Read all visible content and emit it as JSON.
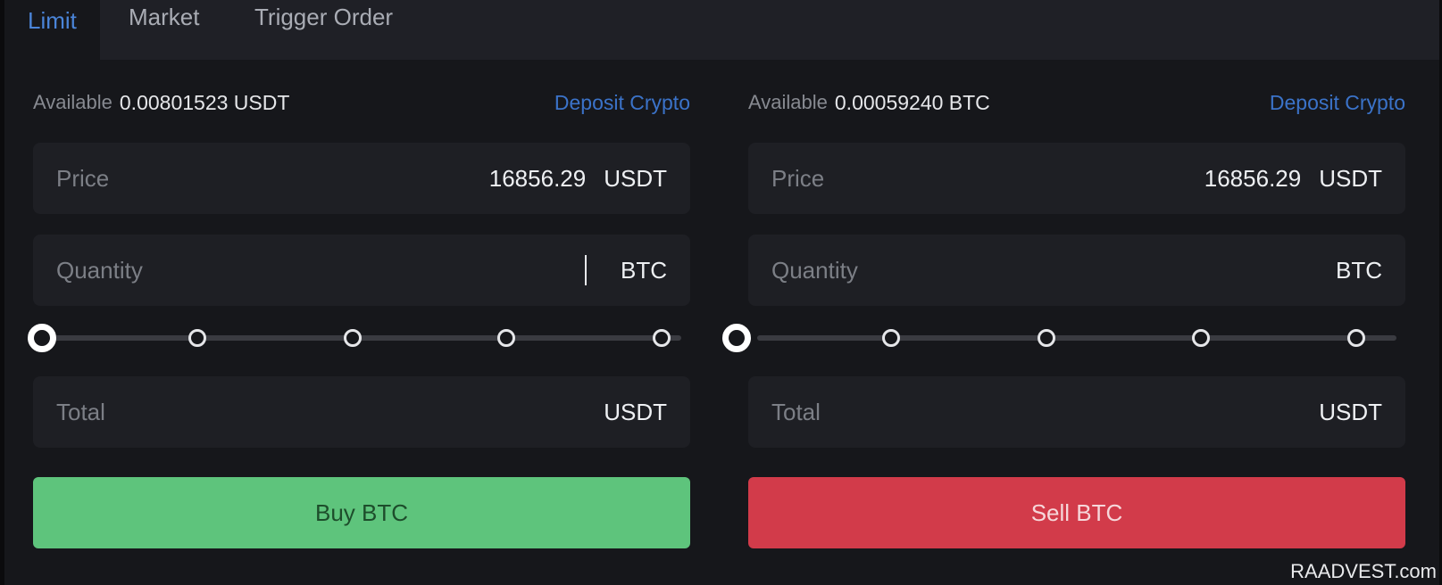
{
  "tabs": [
    {
      "label": "Limit",
      "active": true
    },
    {
      "label": "Market",
      "active": false
    },
    {
      "label": "Trigger Order",
      "active": false
    }
  ],
  "buy": {
    "available_label": "Available",
    "available_value": "0.00801523 USDT",
    "deposit_label": "Deposit Crypto",
    "price_label": "Price",
    "price_value": "16856.29",
    "price_unit": "USDT",
    "quantity_placeholder": "Quantity",
    "quantity_unit": "BTC",
    "total_label": "Total",
    "total_unit": "USDT",
    "slider_percent": 0,
    "button_label": "Buy BTC"
  },
  "sell": {
    "available_label": "Available",
    "available_value": "0.00059240 BTC",
    "deposit_label": "Deposit Crypto",
    "price_label": "Price",
    "price_value": "16856.29",
    "price_unit": "USDT",
    "quantity_placeholder": "Quantity",
    "quantity_unit": "BTC",
    "total_label": "Total",
    "total_unit": "USDT",
    "slider_percent": 0,
    "button_label": "Sell BTC"
  },
  "colors": {
    "accent": "#4a84d8",
    "buy": "#5ec47c",
    "sell": "#d23b4a",
    "background": "#16171b"
  },
  "watermark": "RAADVEST.com"
}
